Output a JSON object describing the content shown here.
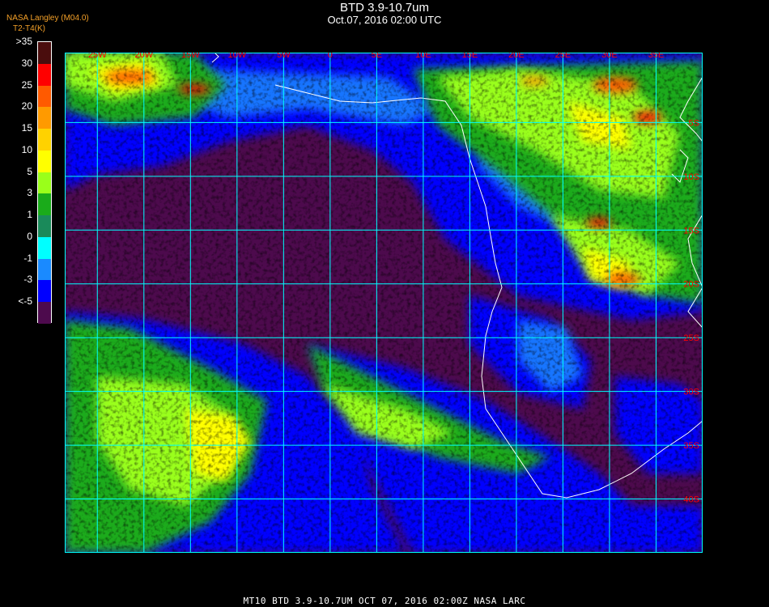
{
  "header": {
    "title": "BTD 3.9-10.7um",
    "subtitle": "Oct.07, 2016 02:00 UTC",
    "credit": "NASA Langley (M04.0)",
    "colorbar_title": "T2-T4(K)"
  },
  "colorbar": {
    "labels": [
      ">35",
      "30",
      "25",
      "20",
      "15",
      "10",
      "5",
      "3",
      "1",
      "0",
      "-1",
      "-3",
      "<-5"
    ],
    "colors": [
      "#4a0d0d",
      "#ff0000",
      "#ff5a00",
      "#ff9a00",
      "#ffd200",
      "#ffff00",
      "#9aff1a",
      "#1aab1a",
      "#1a8a5a",
      "#00ffff",
      "#1a8aff",
      "#0000ff",
      "#4d0a4d"
    ]
  },
  "map": {
    "lon_labels": [
      "25W",
      "20W",
      "15W",
      "10W",
      "5W",
      "0",
      "5E",
      "10E",
      "15E",
      "20E",
      "25E",
      "30E",
      "35E"
    ],
    "lat_labels": [
      "5S",
      "10S",
      "15S",
      "20S",
      "25S",
      "30S",
      "35S",
      "40S"
    ],
    "label_color": "#ff0000",
    "grid_color": "#00ffff",
    "coast_color": "#ffffff"
  },
  "footer": {
    "text": "MT10  BTD 3.9-10.7UM   OCT 07, 2016 02:00Z   NASA LARC"
  }
}
